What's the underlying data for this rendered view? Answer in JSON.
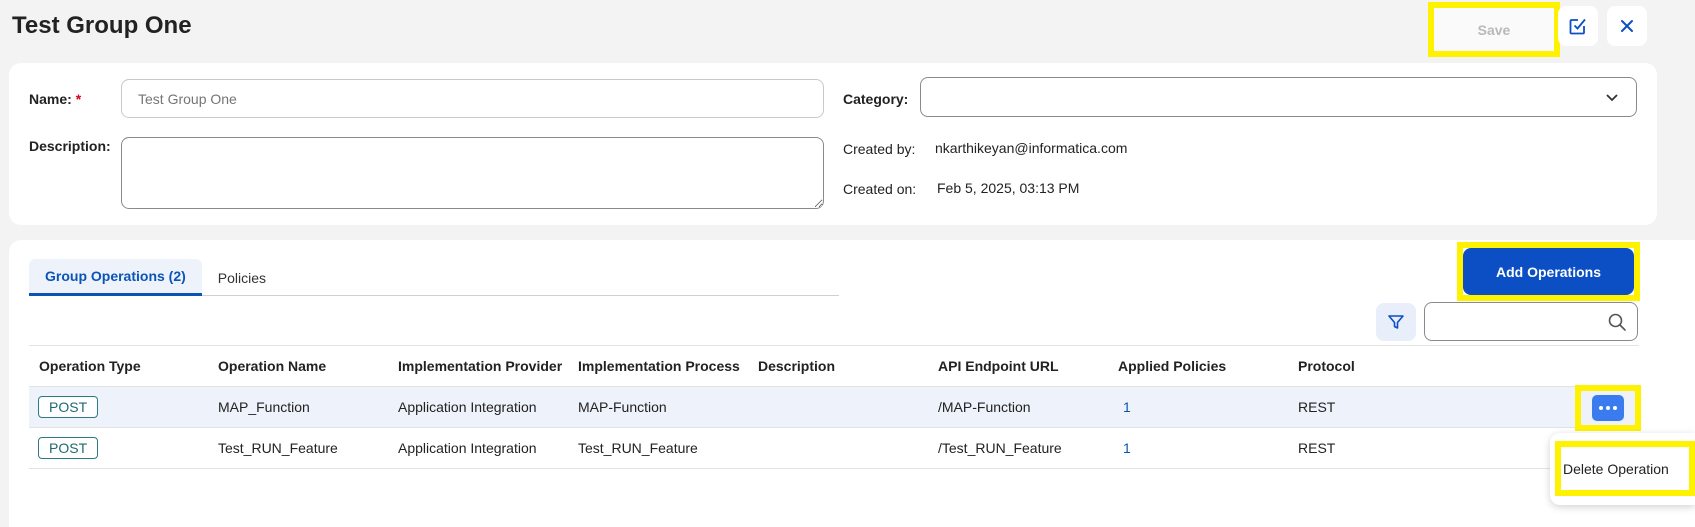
{
  "page": {
    "title": "Test Group One"
  },
  "toolbar": {
    "save_label": "Save"
  },
  "form": {
    "name_label": "Name:",
    "required_mark": "*",
    "name_placeholder": "Test Group One",
    "description_label": "Description:",
    "category_label": "Category:",
    "category_value": "",
    "created_by_label": "Created by:",
    "created_by_value": "nkarthikeyan@informatica.com",
    "created_on_label": "Created on:",
    "created_on_value": "Feb 5, 2025, 03:13 PM"
  },
  "tabs": [
    {
      "label": "Group Operations (2)",
      "active": true
    },
    {
      "label": "Policies",
      "active": false
    }
  ],
  "actions": {
    "add_operations_label": "Add Operations"
  },
  "table": {
    "columns": [
      "Operation Type",
      "Operation Name",
      "Implementation Provider",
      "Implementation Process",
      "Description",
      "API Endpoint URL",
      "Applied Policies",
      "Protocol"
    ],
    "rows": [
      {
        "type": "POST",
        "name": "MAP_Function",
        "provider": "Application Integration",
        "process": "MAP-Function",
        "description": "",
        "url": "/MAP-Function",
        "policies": "1",
        "protocol": "REST"
      },
      {
        "type": "POST",
        "name": "Test_RUN_Feature",
        "provider": "Application Integration",
        "process": "Test_RUN_Feature",
        "description": "",
        "url": "/Test_RUN_Feature",
        "policies": "1",
        "protocol": "REST"
      }
    ]
  },
  "context_menu": {
    "items": [
      {
        "label": "Delete Operation"
      }
    ]
  },
  "colors": {
    "primary": "#0c4fc4",
    "highlight": "#fff200",
    "tab_active": "#0b54b6",
    "badge": "#2e7a82"
  },
  "icons": {
    "check": "checkbox-edit-icon",
    "close": "close-icon",
    "filter": "filter-icon",
    "search": "search-icon",
    "more": "more-horizontal-icon",
    "dropdown": "chevron-down-icon"
  }
}
